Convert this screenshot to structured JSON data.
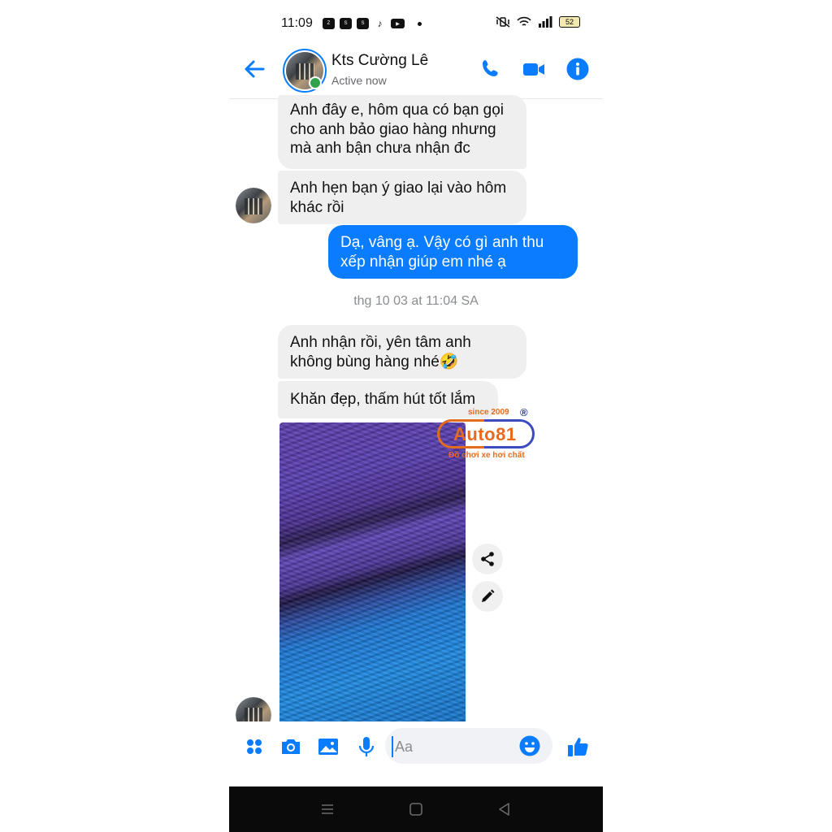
{
  "status_bar": {
    "time": "11:09",
    "app_icons": [
      "zalo-icon",
      "shopee-icon",
      "shop-icon",
      "tiktok-icon",
      "youtube-icon"
    ],
    "battery": "52"
  },
  "header": {
    "contact_name": "Kts Cường Lê",
    "presence": "Active now",
    "accent": "#0a7cff"
  },
  "messages": [
    {
      "side": "in",
      "text": "Anh đây e, hôm qua có bạn gọi cho anh bảo giao hàng nhưng mà anh bận chưa nhận đc"
    },
    {
      "side": "in",
      "text": "Anh hẹn bạn ý giao lại vào hôm khác rồi"
    },
    {
      "side": "out",
      "text": "Dạ, vâng ạ. Vậy có gì anh thu xếp nhận giúp em nhé ạ"
    },
    {
      "side": "in",
      "text": "Anh nhận rồi, yên tâm anh không bùng hàng nhé🤣"
    },
    {
      "side": "in",
      "text": "Khăn đẹp, thấm hút tốt lắm"
    }
  ],
  "timestamp": "thg 10 03 at 11:04 SA",
  "watermark": {
    "since": "since 2009",
    "registered": "®",
    "brand": "Auto81",
    "tagline": "Đồ chơi xe hơi chất"
  },
  "composer": {
    "placeholder": "Aa"
  }
}
